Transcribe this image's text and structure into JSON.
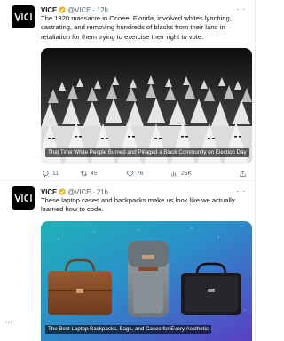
{
  "tweets": [
    {
      "author_name": "VICE",
      "handle": "@VICE",
      "separator": "·",
      "time": "12h",
      "text": "The 1920 massacre in Ocoee, Florida, involved whites lynching, castrating, and removing hundreds of blacks from their land in retaliation for them trying to exercise their right to vote.",
      "media_caption": "That Time White People Burned and Pillaged a Black Community on Election Day",
      "stats": {
        "replies": "11",
        "retweets": "45",
        "likes": "76",
        "views": "25K"
      }
    },
    {
      "author_name": "VICE",
      "handle": "@VICE",
      "separator": "·",
      "time": "21h",
      "text": "These laptop cases and backpacks make us look like we actually learned how to code.",
      "media_caption": "The Best Laptop Backpacks, Bags, and Cases for Every Aesthetic"
    }
  ],
  "more_menu": "···",
  "sidebar_more": "···",
  "icons": {
    "verified": "verified-badge-icon",
    "reply": "reply-icon",
    "retweet": "retweet-icon",
    "like": "heart-icon",
    "views": "views-chart-icon",
    "share": "share-icon"
  },
  "colors": {
    "text_primary": "#0f1419",
    "text_secondary": "#536471",
    "verified_gold": "#e8b829",
    "caption_bg": "#000000"
  }
}
